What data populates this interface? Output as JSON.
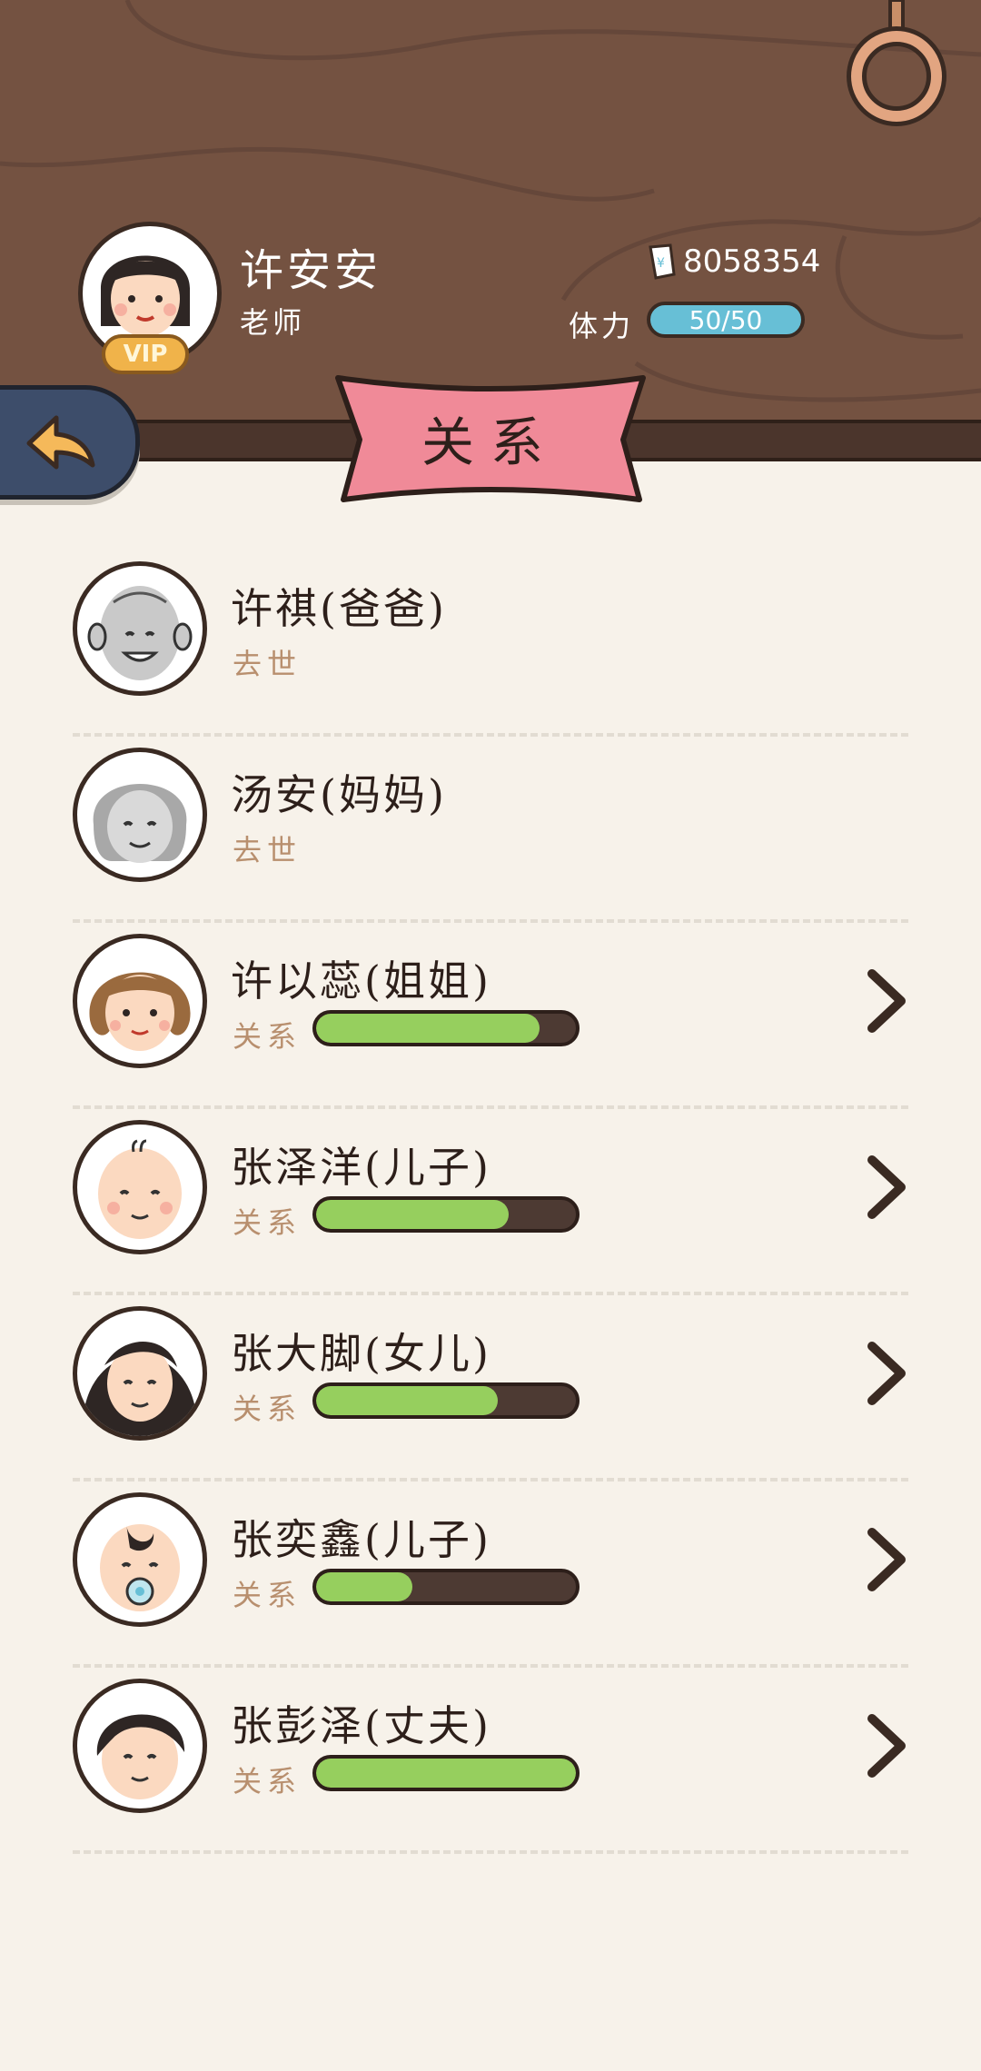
{
  "player": {
    "name": "许安安",
    "title": "老师",
    "badge": "VIP",
    "money": "8058354",
    "stamina_label": "体力",
    "stamina_value": "50/50"
  },
  "page_title": "关系",
  "relationships": [
    {
      "name": "许祺(爸爸)",
      "status": "去世",
      "deceased": true,
      "avatar": "elderly-man-avatar"
    },
    {
      "name": "汤安(妈妈)",
      "status": "去世",
      "deceased": true,
      "avatar": "elderly-woman-avatar"
    },
    {
      "name": "许以蕊(姐姐)",
      "status": "关系",
      "deceased": false,
      "level": 0.86,
      "avatar": "woman-avatar"
    },
    {
      "name": "张泽洋(儿子)",
      "status": "关系",
      "deceased": false,
      "level": 0.74,
      "avatar": "baby-boy-avatar"
    },
    {
      "name": "张大脚(女儿)",
      "status": "关系",
      "deceased": false,
      "level": 0.7,
      "avatar": "girl-avatar"
    },
    {
      "name": "张奕鑫(儿子)",
      "status": "关系",
      "deceased": false,
      "level": 0.37,
      "avatar": "baby-pacifier-avatar"
    },
    {
      "name": "张彭泽(丈夫)",
      "status": "关系",
      "deceased": false,
      "level": 1.0,
      "avatar": "man-avatar"
    }
  ],
  "colors": {
    "wood": "#745241",
    "bar_fill": "#96cf5e",
    "bar_track": "#4d3a33",
    "banner": "#f08a98",
    "stamina": "#67bfd6"
  }
}
